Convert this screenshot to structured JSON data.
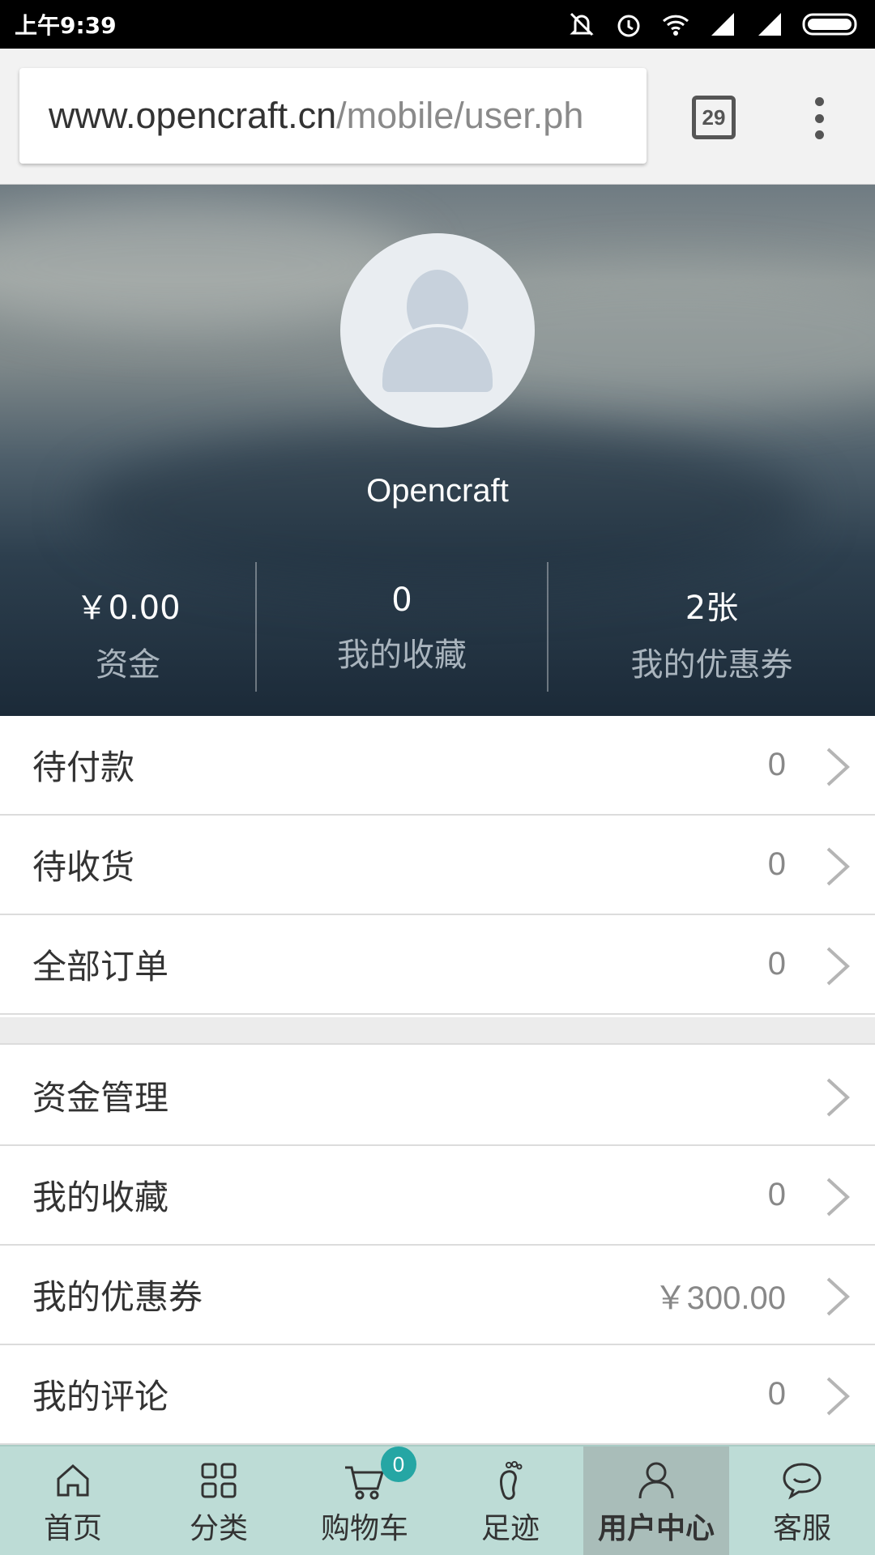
{
  "status_bar": {
    "time": "上午9:39"
  },
  "browser": {
    "url_domain": "www.opencraft.cn",
    "url_path": "/mobile/user.ph",
    "tab_count": "29"
  },
  "profile": {
    "username": "Opencraft",
    "stats": [
      {
        "value": "￥0.00",
        "label": "资金"
      },
      {
        "value": "0",
        "label": "我的收藏"
      },
      {
        "value": "2张",
        "label": "我的优惠券"
      }
    ]
  },
  "orders": [
    {
      "label": "待付款",
      "value": "0"
    },
    {
      "label": "待收货",
      "value": "0"
    },
    {
      "label": "全部订单",
      "value": "0"
    }
  ],
  "account": [
    {
      "label": "资金管理",
      "value": ""
    },
    {
      "label": "我的收藏",
      "value": "0"
    },
    {
      "label": "我的优惠券",
      "value": "￥300.00"
    },
    {
      "label": "我的评论",
      "value": "0"
    }
  ],
  "bottom_nav": {
    "items": [
      {
        "label": "首页",
        "icon": "home-icon"
      },
      {
        "label": "分类",
        "icon": "grid-icon"
      },
      {
        "label": "购物车",
        "icon": "cart-icon",
        "badge": "0"
      },
      {
        "label": "足迹",
        "icon": "footprint-icon"
      },
      {
        "label": "用户中心",
        "icon": "user-icon",
        "active": true
      },
      {
        "label": "客服",
        "icon": "chat-icon"
      }
    ]
  }
}
